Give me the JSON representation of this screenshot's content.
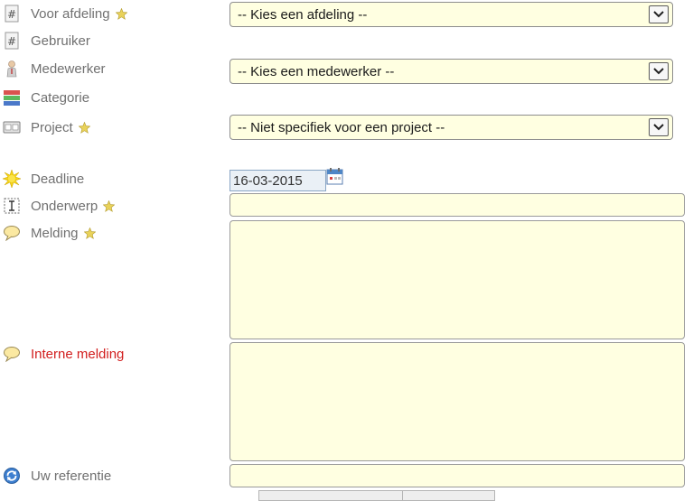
{
  "fields": {
    "afdeling": {
      "label": "Voor afdeling",
      "required": true
    },
    "gebruiker": {
      "label": "Gebruiker",
      "required": false
    },
    "medewerker": {
      "label": "Medewerker",
      "required": false
    },
    "categorie": {
      "label": "Categorie",
      "required": false
    },
    "project": {
      "label": "Project",
      "required": true
    },
    "deadline": {
      "label": "Deadline",
      "value": "16-03-2015"
    },
    "onderwerp": {
      "label": "Onderwerp",
      "required": true,
      "value": ""
    },
    "melding": {
      "label": "Melding",
      "required": true,
      "value": ""
    },
    "interne_melding": {
      "label": "Interne melding",
      "value": ""
    },
    "referentie": {
      "label": "Uw referentie",
      "value": ""
    }
  },
  "selects": {
    "afdeling": "-- Kies een afdeling --",
    "medewerker": "-- Kies een medewerker --",
    "project": "-- Niet specifiek voor een project --"
  },
  "icons": {
    "afdeling": "hash-doc-icon",
    "gebruiker": "hash-doc-icon",
    "medewerker": "person-icon",
    "categorie": "category-stack-icon",
    "project": "project-card-icon",
    "deadline": "sun-icon",
    "onderwerp": "text-cursor-icon",
    "melding": "speech-bubble-icon",
    "interne_melding": "speech-bubble-icon",
    "referentie": "refresh-icon",
    "required": "star-icon",
    "calendar": "calendar-icon"
  },
  "colors": {
    "field_bg": "#ffffe1",
    "label": "#707070",
    "internal_label": "#d21f1f"
  }
}
